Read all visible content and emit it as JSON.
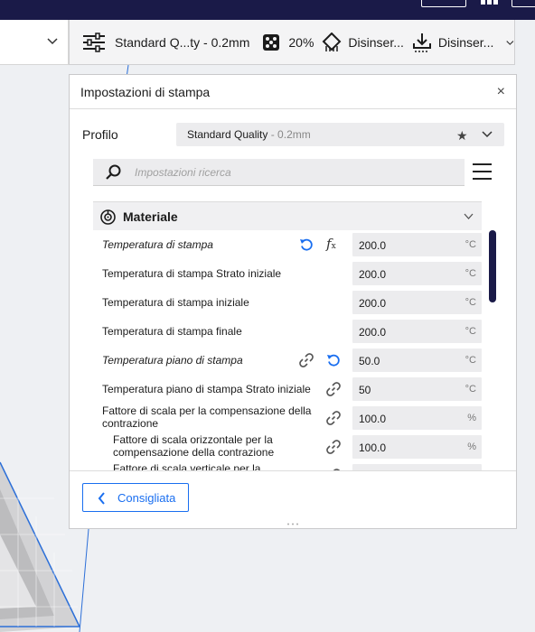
{
  "colors": {
    "accent": "#196ef0",
    "top_bar": "#1a1a48",
    "scrollbar": "#1a1a48",
    "field_bg": "#ececee"
  },
  "print_setup": {
    "profile_summary": "Standard Q...ty - 0.2mm",
    "infill": "20%",
    "support": "Disinser...",
    "adhesion": "Disinser...",
    "icons": [
      "sliders-icon",
      "infill-icon",
      "support-icon",
      "adhesion-icon",
      "chevron-down-icon"
    ]
  },
  "panel": {
    "title": "Impostazioni di stampa",
    "close_label": "×",
    "profile_label": "Profilo",
    "profile_name": "Standard Quality",
    "profile_layer": " - 0.2mm",
    "search_placeholder": "Impostazioni ricerca",
    "category": "Materiale",
    "recommended_button": "Consigliata"
  },
  "settings": [
    {
      "label": "Temperatura di stampa",
      "value": "200.0",
      "unit": "°C",
      "italic": true,
      "icons": [
        "reset-icon",
        "function-icon"
      ]
    },
    {
      "label": "Temperatura di stampa Strato iniziale",
      "value": "200.0",
      "unit": "°C",
      "italic": false,
      "icons": []
    },
    {
      "label": "Temperatura di stampa iniziale",
      "value": "200.0",
      "unit": "°C",
      "italic": false,
      "icons": []
    },
    {
      "label": "Temperatura di stampa finale",
      "value": "200.0",
      "unit": "°C",
      "italic": false,
      "icons": []
    },
    {
      "label": "Temperatura piano di stampa",
      "value": "50.0",
      "unit": "°C",
      "italic": true,
      "icons": [
        "link-icon",
        "reset-icon"
      ]
    },
    {
      "label": "Temperatura piano di stampa Strato iniziale",
      "value": "50",
      "unit": "°C",
      "italic": false,
      "icons": [
        "link-icon"
      ]
    },
    {
      "label": "Fattore di scala per la compensazione della contrazione",
      "value": "100.0",
      "unit": "%",
      "italic": false,
      "icons": [
        "link-icon"
      ]
    },
    {
      "label": "Fattore di scala orizzontale per la compensazione della contrazione",
      "value": "100.0",
      "unit": "%",
      "italic": false,
      "icons": [
        "link-icon"
      ]
    },
    {
      "label": "Fattore di scala verticale per la",
      "value": "",
      "unit": "",
      "italic": false,
      "icons": [
        "link-icon"
      ]
    }
  ]
}
